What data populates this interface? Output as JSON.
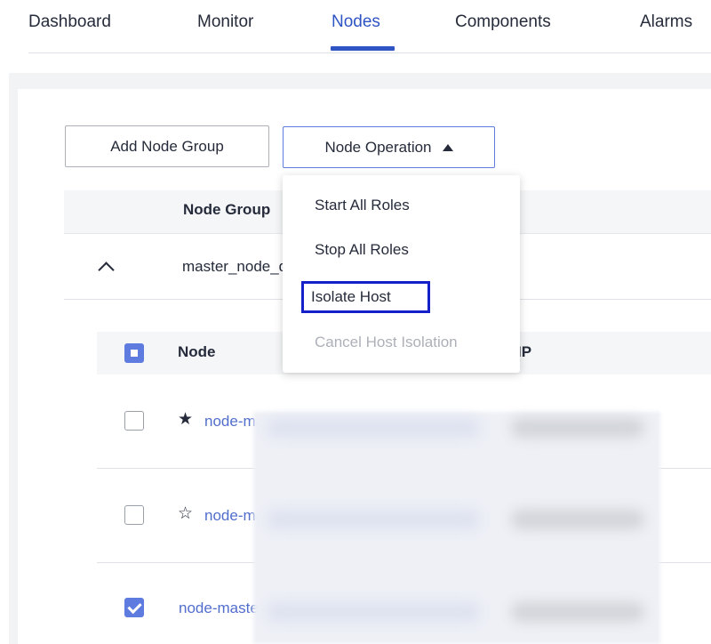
{
  "tabs": [
    {
      "label": "Dashboard",
      "active": false
    },
    {
      "label": "Monitor",
      "active": false
    },
    {
      "label": "Nodes",
      "active": true
    },
    {
      "label": "Components",
      "active": false
    },
    {
      "label": "Alarms",
      "active": false
    }
  ],
  "toolbar": {
    "add_node_group_label": "Add Node Group",
    "node_operation_label": "Node Operation"
  },
  "node_operation_menu": {
    "items": [
      {
        "label": "Start All Roles",
        "disabled": false
      },
      {
        "label": "Stop All Roles",
        "disabled": false
      },
      {
        "label": "Isolate Host",
        "disabled": false,
        "focused": true
      },
      {
        "label": "Cancel Host Isolation",
        "disabled": true
      }
    ]
  },
  "group_table": {
    "header": "Node Group",
    "row": {
      "name": "master_node_default_group",
      "expanded": true
    }
  },
  "node_table": {
    "header_checkbox": "partial",
    "columns": [
      "Node",
      "IP"
    ],
    "rows": [
      {
        "name": "node-master1",
        "star": "filled",
        "checked": false
      },
      {
        "name": "node-master2",
        "star": "outline",
        "checked": false
      },
      {
        "name": "node-master3",
        "star": "",
        "checked": true
      }
    ]
  },
  "colors": {
    "accent": "#2f54c4",
    "link": "#526ecc",
    "checkbox": "#5e7ce0",
    "focus_outline": "#1520c8"
  }
}
